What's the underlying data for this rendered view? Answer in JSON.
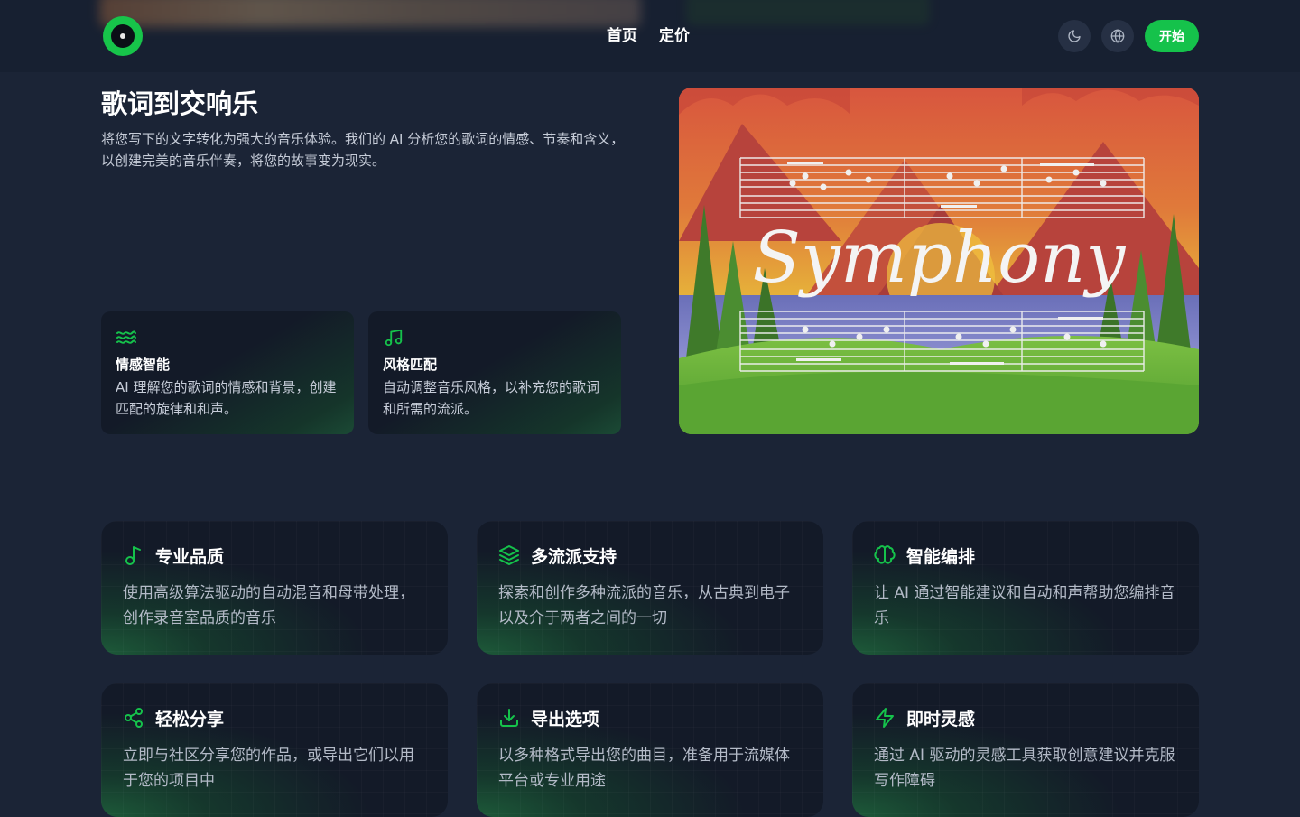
{
  "nav": {
    "home": "首页",
    "pricing": "定价",
    "start": "开始"
  },
  "hero": {
    "title": "歌词到交响乐",
    "description": "将您写下的文字转化为强大的音乐体验。我们的 AI 分析您的歌词的情感、节奏和含义，以创建完美的音乐伴奏，将您的故事变为现实。",
    "cards": [
      {
        "icon": "waves-icon",
        "title": "情感智能",
        "text": "AI 理解您的歌词的情感和背景，创建匹配的旋律和和声。"
      },
      {
        "icon": "music-notes-icon",
        "title": "风格匹配",
        "text": "自动调整音乐风格，以补充您的歌词和所需的流派。"
      }
    ],
    "art_text": "Symphony"
  },
  "features": [
    {
      "icon": "music-note-icon",
      "title": "专业品质",
      "text": "使用高级算法驱动的自动混音和母带处理，创作录音室品质的音乐"
    },
    {
      "icon": "layers-icon",
      "title": "多流派支持",
      "text": "探索和创作多种流派的音乐，从古典到电子以及介于两者之间的一切"
    },
    {
      "icon": "brain-icon",
      "title": "智能编排",
      "text": "让 AI 通过智能建议和自动和声帮助您编排音乐"
    },
    {
      "icon": "share-icon",
      "title": "轻松分享",
      "text": "立即与社区分享您的作品，或导出它们以用于您的项目中"
    },
    {
      "icon": "download-icon",
      "title": "导出选项",
      "text": "以多种格式导出您的曲目，准备用于流媒体平台或专业用途"
    },
    {
      "icon": "zap-icon",
      "title": "即时灵感",
      "text": "通过 AI 驱动的灵感工具获取创意建议并克服写作障碍"
    }
  ],
  "colors": {
    "accent": "#15c24b",
    "background": "#1b2436",
    "card": "#131a28"
  }
}
